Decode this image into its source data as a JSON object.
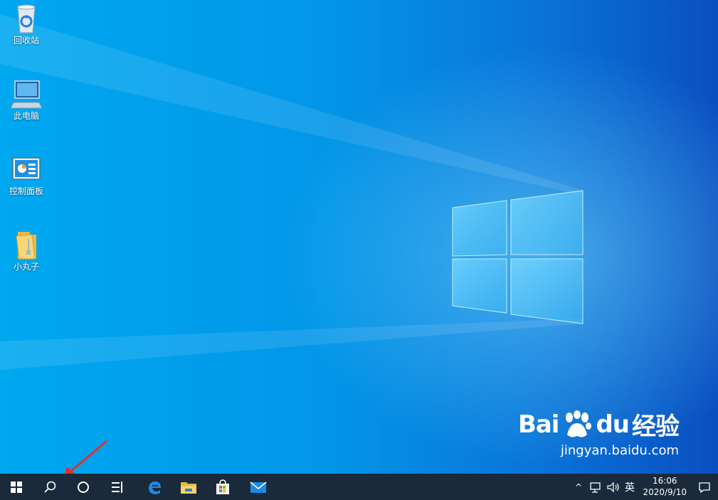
{
  "desktop": {
    "icons": [
      {
        "label": "回收站",
        "icon": "recycle-bin-icon"
      },
      {
        "label": "此电脑",
        "icon": "computer-icon"
      },
      {
        "label": "控制面板",
        "icon": "control-panel-icon"
      },
      {
        "label": "小丸子",
        "icon": "folder-icon"
      }
    ]
  },
  "watermark": {
    "brand_a": "Bai",
    "brand_b": "du",
    "brand_c": "经验",
    "site": "jingyan.baidu.com"
  },
  "taskbar": {
    "buttons": [
      "start-icon",
      "search-icon",
      "cortana-icon",
      "task-view-icon",
      "edge-icon",
      "file-explorer-icon",
      "store-icon",
      "mail-icon"
    ],
    "tray": {
      "chevron": "^",
      "language": "英"
    },
    "clock": {
      "time": "16:06",
      "date": "2020/9/10"
    }
  },
  "colors": {
    "taskbar": "#1a2a3a",
    "accent": "#0078d7"
  }
}
